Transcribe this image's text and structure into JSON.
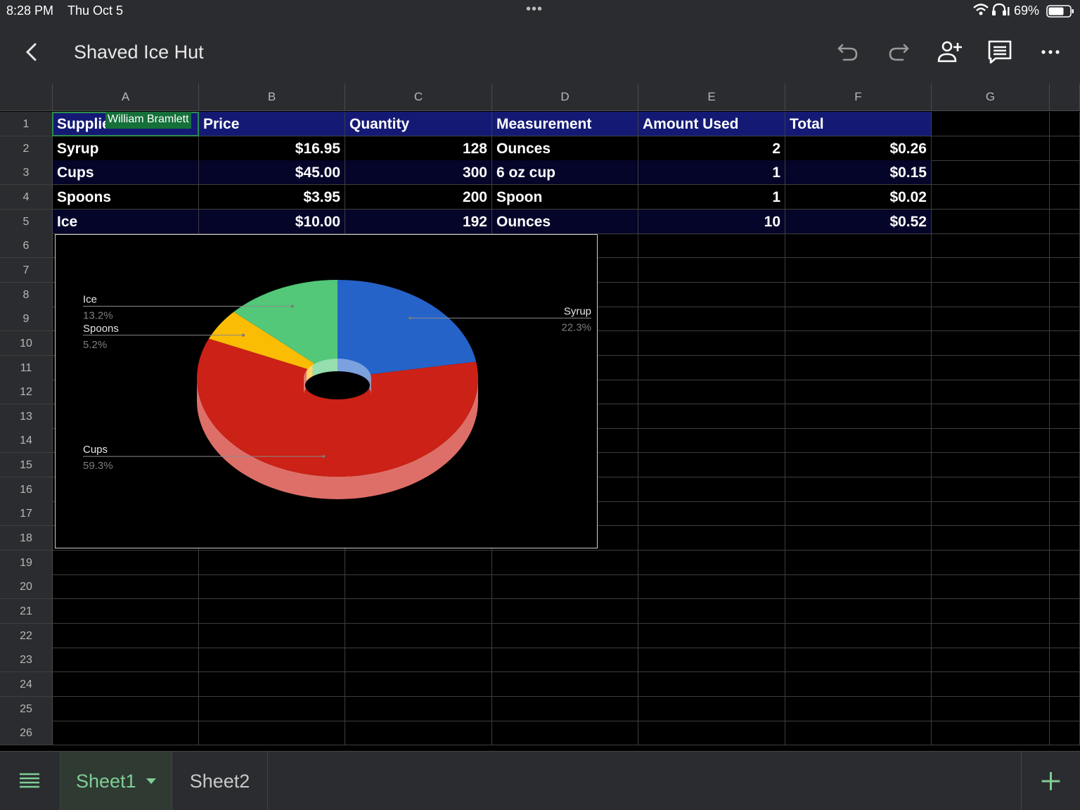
{
  "status": {
    "time": "8:28 PM",
    "date": "Thu Oct 5",
    "dots": "•••",
    "battery": "69%"
  },
  "appbar": {
    "title": "Shaved Ice Hut"
  },
  "columns": [
    "A",
    "B",
    "C",
    "D",
    "E",
    "F",
    "G"
  ],
  "rows": [
    "1",
    "2",
    "3",
    "4",
    "5",
    "6",
    "7",
    "8",
    "9",
    "10",
    "11",
    "12",
    "13",
    "14",
    "15",
    "16",
    "17",
    "18",
    "19",
    "20",
    "21",
    "22",
    "23",
    "24",
    "25",
    "26"
  ],
  "sheet": {
    "header": [
      "Supplies",
      "Price",
      "Quantity",
      "Measurement",
      "Amount Used",
      "Total"
    ],
    "data": [
      [
        "Syrup",
        "$16.95",
        "128",
        "Ounces",
        "2",
        "$0.26"
      ],
      [
        "Cups",
        "$45.00",
        "300",
        "6 oz cup",
        "1",
        "$0.15"
      ],
      [
        "Spoons",
        "$3.95",
        "200",
        "Spoon",
        "1",
        "$0.02"
      ],
      [
        "Ice",
        "$10.00",
        "192",
        "Ounces",
        "10",
        "$0.52"
      ]
    ]
  },
  "collaborator": {
    "name": "William Bramlett",
    "color": "#15703a"
  },
  "chart_data": {
    "type": "pie",
    "style": "3d-donut",
    "slices": [
      {
        "label": "Syrup",
        "value": 22.3,
        "display": "22.3%",
        "color": "#2563c9"
      },
      {
        "label": "Cups",
        "value": 59.3,
        "display": "59.3%",
        "color": "#cc2116"
      },
      {
        "label": "Spoons",
        "value": 5.2,
        "display": "5.2%",
        "color": "#fbbc04"
      },
      {
        "label": "Ice",
        "value": 13.2,
        "display": "13.2%",
        "color": "#52c878"
      }
    ]
  },
  "tabs": [
    {
      "label": "Sheet1",
      "active": true
    },
    {
      "label": "Sheet2",
      "active": false
    }
  ],
  "colors": {
    "header_fill": "#141a74",
    "accent_green": "#7fce95"
  }
}
